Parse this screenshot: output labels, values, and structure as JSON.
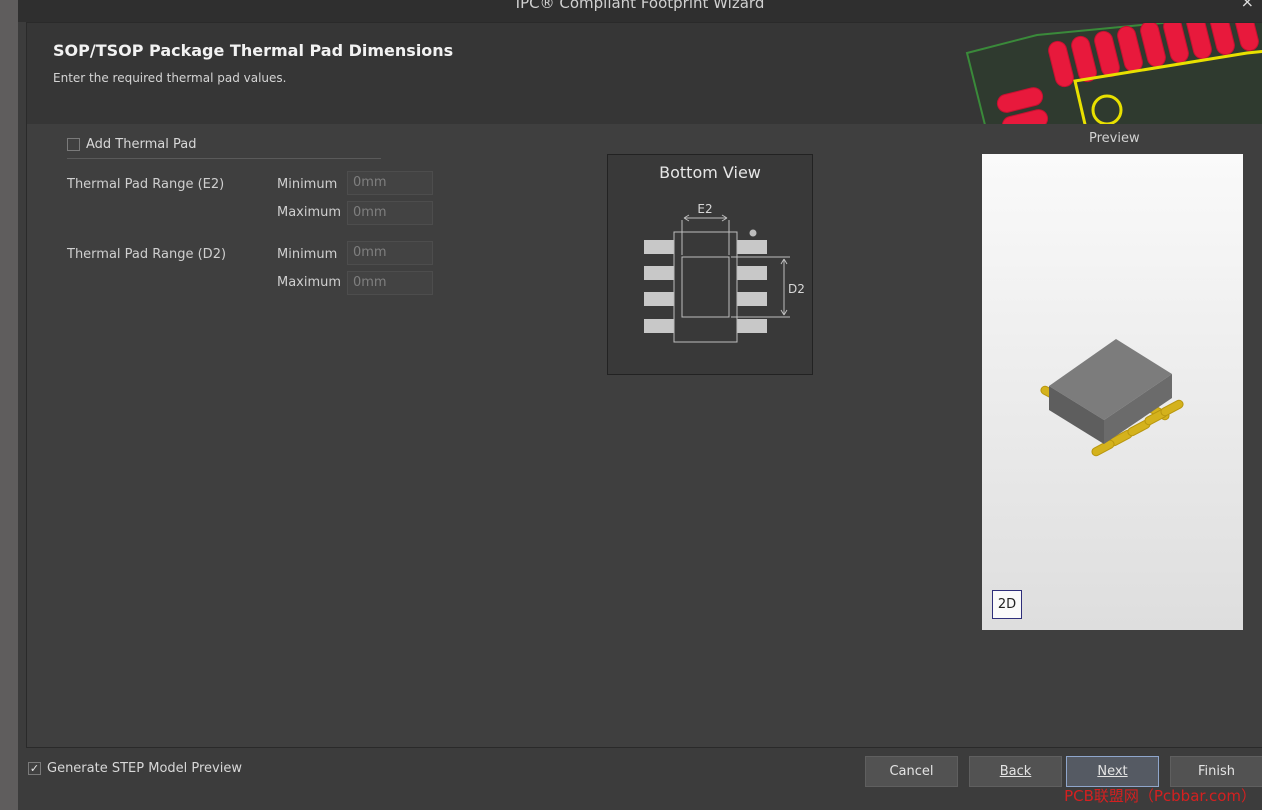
{
  "window": {
    "title": "IPC® Compliant Footprint Wizard",
    "close_glyph": "×"
  },
  "header": {
    "title": "SOP/TSOP Package Thermal Pad Dimensions",
    "subtitle": "Enter the required thermal pad values."
  },
  "form": {
    "add_thermal_pad": {
      "label": "Add Thermal Pad",
      "checked": false
    },
    "e2": {
      "label": "Thermal Pad Range (E2)",
      "min_label": "Minimum",
      "min_value": "0mm",
      "max_label": "Maximum",
      "max_value": "0mm"
    },
    "d2": {
      "label": "Thermal Pad Range (D2)",
      "min_label": "Minimum",
      "min_value": "0mm",
      "max_label": "Maximum",
      "max_value": "0mm"
    }
  },
  "bottom_view": {
    "title": "Bottom View",
    "e2_label": "E2",
    "d2_label": "D2"
  },
  "preview": {
    "label": "Preview",
    "mode_button": "2D"
  },
  "footer": {
    "generate_step": {
      "label": "Generate STEP Model Preview",
      "checked": true
    },
    "buttons": {
      "cancel": "Cancel",
      "back": "Back",
      "next": "Next",
      "finish": "Finish"
    }
  },
  "watermark": "PCB联盟网（Pcbbar.com）",
  "colors": {
    "pad_red": "#e8193c",
    "silk_yellow": "#e8e000",
    "board_green": "#3a8a3a",
    "gold_lead": "#d4b21c",
    "body_gray": "#6b6b6b"
  }
}
